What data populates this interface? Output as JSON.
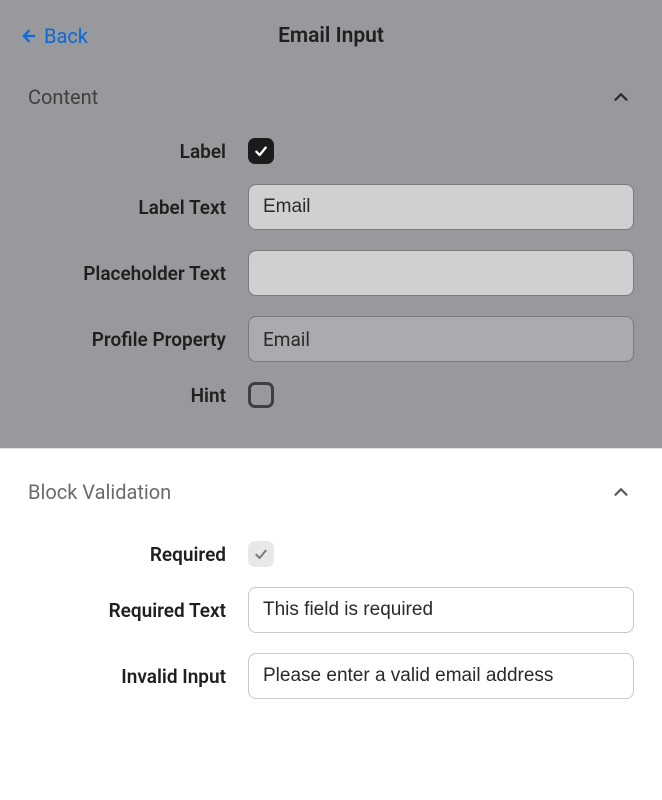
{
  "header": {
    "back_label": "Back",
    "title": "Email Input"
  },
  "content": {
    "section_title": "Content",
    "label": {
      "label": "Label",
      "checked": true
    },
    "label_text": {
      "label": "Label Text",
      "value": "Email"
    },
    "placeholder_text": {
      "label": "Placeholder Text",
      "value": ""
    },
    "profile_property": {
      "label": "Profile Property",
      "value": "Email"
    },
    "hint": {
      "label": "Hint",
      "checked": false
    }
  },
  "validation": {
    "section_title": "Block Validation",
    "required": {
      "label": "Required",
      "checked": true
    },
    "required_text": {
      "label": "Required Text",
      "value": "This field is required"
    },
    "invalid_input": {
      "label": "Invalid Input",
      "value": "Please enter a valid email address"
    }
  }
}
